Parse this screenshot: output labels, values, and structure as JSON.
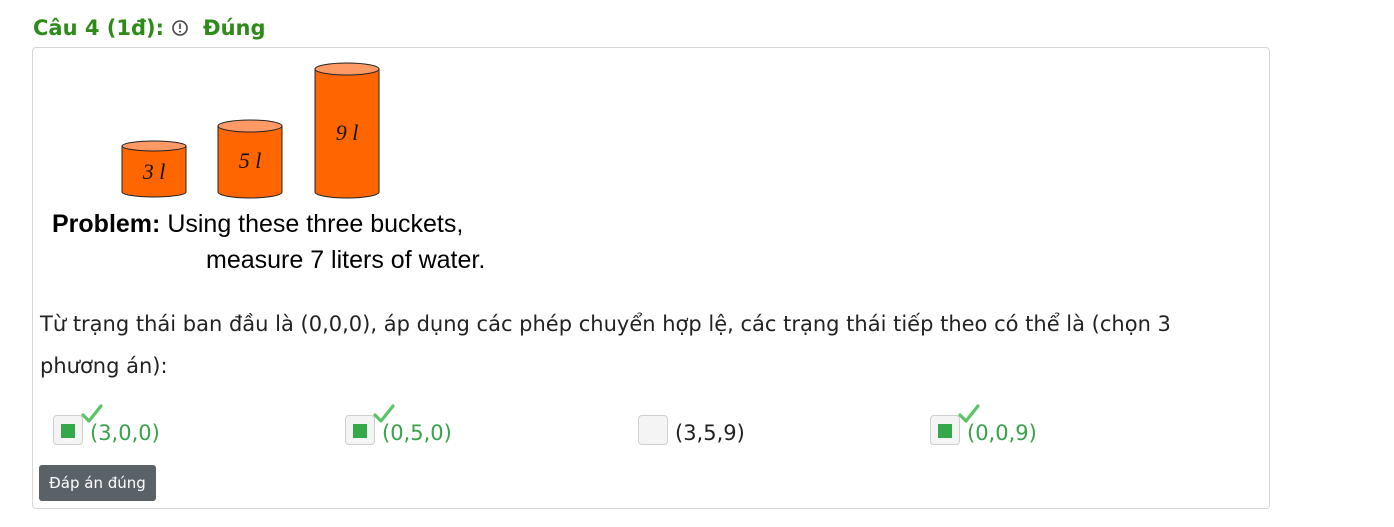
{
  "header": {
    "question_label": "Câu 4 (1đ):",
    "status": "Đúng",
    "info_icon": "exclamation-circle-icon"
  },
  "figure": {
    "buckets": [
      {
        "label": "3 l"
      },
      {
        "label": "5 l"
      },
      {
        "label": "9 l"
      }
    ],
    "problem_bold": "Problem:",
    "problem_line1": "Using these three buckets,",
    "problem_line2": "measure 7 liters of water."
  },
  "question_text": "Từ trạng thái ban đầu là (0,0,0), áp dụng các phép chuyển hợp lệ, các trạng thái tiếp theo có thể là (chọn 3 phương án):",
  "options": [
    {
      "label": "(3,0,0)",
      "checked": true,
      "correct": true
    },
    {
      "label": "(0,5,0)",
      "checked": true,
      "correct": true
    },
    {
      "label": "(3,5,9)",
      "checked": false,
      "correct": false
    },
    {
      "label": "(0,0,9)",
      "checked": true,
      "correct": true
    }
  ],
  "answer_button": "Đáp án đúng",
  "colors": {
    "header_green": "#2e8b19",
    "correct_green": "#37a24a",
    "bucket_orange": "#ff6600",
    "bucket_top": "#ff9966",
    "button_gray": "#5a6268"
  }
}
